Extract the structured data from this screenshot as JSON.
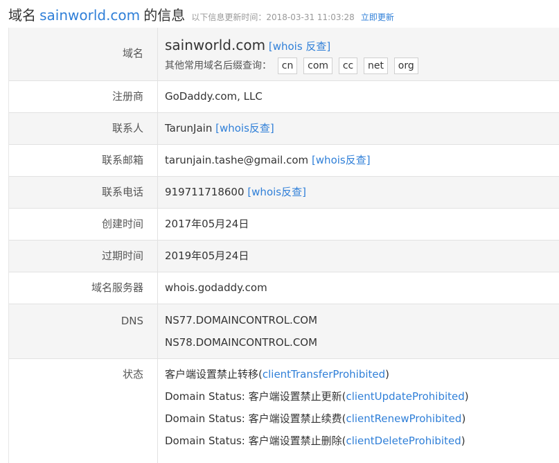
{
  "header": {
    "prefix": "域名",
    "domain": "sainworld.com",
    "suffix": "的信息",
    "update_meta": "以下信息更新时间：2018-03-31 11:03:28",
    "update_link": "立即更新"
  },
  "rows": {
    "domain": {
      "label": "域名",
      "value": "sainworld.com",
      "whois_link": "[whois 反查]",
      "suffix_label": "其他常用域名后缀查询：",
      "suffixes": [
        "cn",
        "com",
        "cc",
        "net",
        "org"
      ]
    },
    "registrar": {
      "label": "注册商",
      "value": "GoDaddy.com, LLC"
    },
    "contact": {
      "label": "联系人",
      "value": "TarunJain",
      "link": "[whois反查]"
    },
    "email": {
      "label": "联系邮箱",
      "value": "tarunjain.tashe@gmail.com",
      "link": "[whois反查]"
    },
    "phone": {
      "label": "联系电话",
      "value": "919711718600",
      "link": "[whois反查]"
    },
    "created": {
      "label": "创建时间",
      "value": "2017年05月24日"
    },
    "expires": {
      "label": "过期时间",
      "value": "2019年05月24日"
    },
    "whois_server": {
      "label": "域名服务器",
      "value": "whois.godaddy.com"
    },
    "dns": {
      "label": "DNS",
      "values": [
        "NS77.DOMAINCONTROL.COM",
        "NS78.DOMAINCONTROL.COM"
      ]
    },
    "status": {
      "label": "状态",
      "lines": [
        {
          "prefix": "客户端设置禁止转移(",
          "link": "clientTransferProhibited",
          "suffix": ")"
        },
        {
          "prefix": "Domain Status: 客户端设置禁止更新(",
          "link": "clientUpdateProhibited",
          "suffix": ")"
        },
        {
          "prefix": "Domain Status: 客户端设置禁止续费(",
          "link": "clientRenewProhibited",
          "suffix": ")"
        },
        {
          "prefix": "Domain Status: 客户端设置禁止删除(",
          "link": "clientDeleteProhibited",
          "suffix": ")"
        }
      ]
    }
  }
}
